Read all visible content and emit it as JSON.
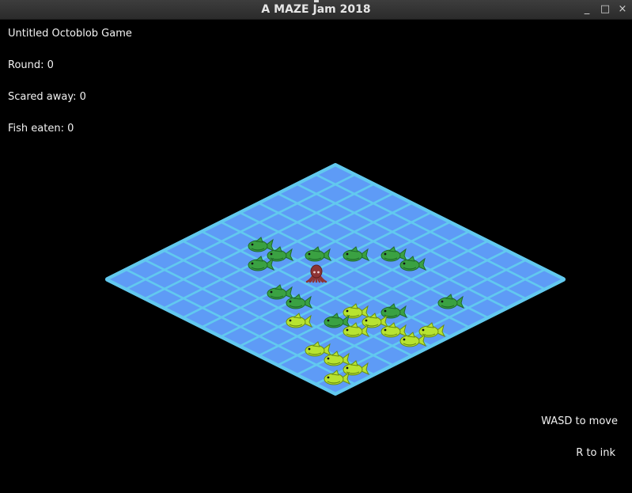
{
  "window": {
    "title": "A MAZE Jam 2018",
    "controls": [
      "_",
      "□",
      "×"
    ]
  },
  "hud": {
    "game_title": "Untitled Octoblob Game",
    "round_text": "Round: 0",
    "scared_text": "Scared away: 0",
    "eaten_text": "Fish eaten: 0",
    "help_move": "WASD to move",
    "help_ink": "R to ink"
  },
  "board": {
    "size": 12,
    "colors": {
      "tile": "#5e9bf6",
      "grid": "#62c9ef",
      "fish_dark": "#3aa142",
      "fish_light": "#b8e330",
      "octopus": "#8e3434"
    },
    "octopus": {
      "col": 5,
      "row": 6
    },
    "fish": [
      {
        "col": 2,
        "row": 6,
        "kind": "dark"
      },
      {
        "col": 3,
        "row": 6,
        "kind": "dark"
      },
      {
        "col": 3,
        "row": 7,
        "kind": "dark"
      },
      {
        "col": 4,
        "row": 5,
        "kind": "dark"
      },
      {
        "col": 5,
        "row": 4,
        "kind": "dark"
      },
      {
        "col": 5,
        "row": 8,
        "kind": "dark"
      },
      {
        "col": 6,
        "row": 3,
        "kind": "dark"
      },
      {
        "col": 6,
        "row": 8,
        "kind": "dark"
      },
      {
        "col": 7,
        "row": 3,
        "kind": "dark"
      },
      {
        "col": 8,
        "row": 8,
        "kind": "dark"
      },
      {
        "col": 9,
        "row": 6,
        "kind": "dark"
      },
      {
        "col": 10,
        "row": 4,
        "kind": "dark"
      },
      {
        "col": 7,
        "row": 9,
        "kind": "light"
      },
      {
        "col": 8,
        "row": 7,
        "kind": "light"
      },
      {
        "col": 9,
        "row": 7,
        "kind": "light"
      },
      {
        "col": 9,
        "row": 8,
        "kind": "light"
      },
      {
        "col": 9,
        "row": 10,
        "kind": "light"
      },
      {
        "col": 10,
        "row": 7,
        "kind": "light"
      },
      {
        "col": 10,
        "row": 10,
        "kind": "light"
      },
      {
        "col": 11,
        "row": 6,
        "kind": "light"
      },
      {
        "col": 11,
        "row": 7,
        "kind": "light"
      },
      {
        "col": 11,
        "row": 10,
        "kind": "light"
      },
      {
        "col": 11,
        "row": 11,
        "kind": "light"
      }
    ]
  }
}
